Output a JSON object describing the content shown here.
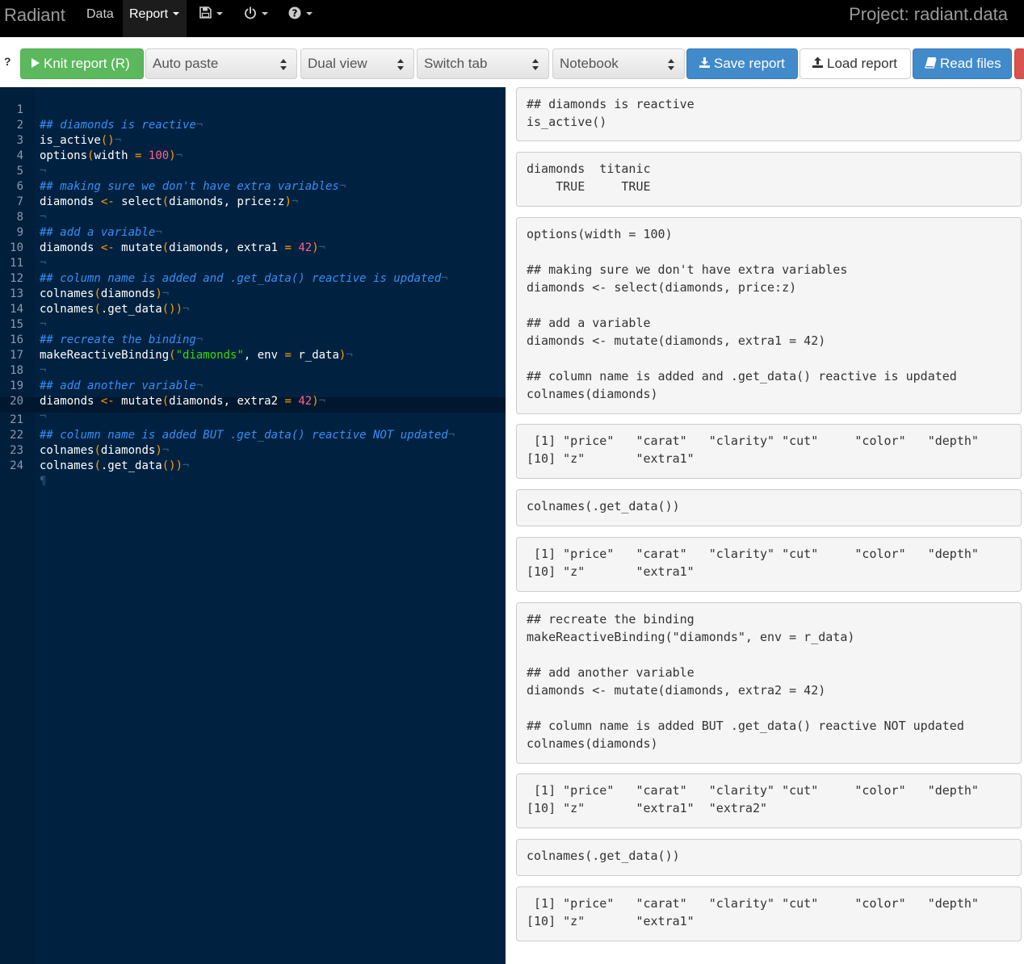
{
  "navbar": {
    "brand": "Radiant",
    "items": [
      {
        "label": "Data"
      },
      {
        "label": "Report"
      }
    ],
    "project": "Project: radiant.data"
  },
  "toolbar": {
    "help": "?",
    "knit_label": "Knit report (R)",
    "auto_paste": "Auto paste",
    "dual_view": "Dual view",
    "switch_tab": "Switch tab",
    "notebook": "Notebook",
    "save_report": "Save report",
    "load_report": "Load report",
    "read_files": "Read files"
  },
  "editor": {
    "lines": [
      "1",
      "2",
      "3",
      "4",
      "5",
      "6",
      "7",
      "8",
      "9",
      "10",
      "11",
      "12",
      "13",
      "14",
      "15",
      "16",
      "17",
      "18",
      "19",
      "20",
      "21",
      "22",
      "23",
      "24"
    ],
    "active_line": 21,
    "code": {
      "l1": "## diamonds is reactive",
      "l2a": "is_active",
      "l2b": "()",
      "l3a": "options",
      "l3b": "(",
      "l3c": "width ",
      "l3d": "=",
      "l3e": " ",
      "l3f": "100",
      "l3g": ")",
      "l5": "## making sure we don't have extra variables",
      "l6a": "diamonds ",
      "l6b": "<-",
      "l6c": " select",
      "l6d": "(",
      "l6e": "diamonds, price:z",
      "l6f": ")",
      "l8": "## add a variable",
      "l9a": "diamonds ",
      "l9b": "<-",
      "l9c": " mutate",
      "l9d": "(",
      "l9e": "diamonds, extra1 ",
      "l9f": "=",
      "l9g": " ",
      "l9h": "42",
      "l9i": ")",
      "l11": "## column name is added and .get_data() reactive is updated",
      "l12a": "colnames",
      "l12b": "(",
      "l12c": "diamonds",
      "l12d": ")",
      "l13a": "colnames",
      "l13b": "(",
      "l13c": ".get_data",
      "l13d": "())",
      "l15": "## recreate the binding",
      "l16a": "makeReactiveBinding",
      "l16b": "(",
      "l16c": "\"diamonds\"",
      "l16d": ", env ",
      "l16e": "=",
      "l16f": " r_data",
      "l16g": ")",
      "l18": "## add another variable",
      "l19a": "diamonds ",
      "l19b": "<-",
      "l19c": " mutate",
      "l19d": "(",
      "l19e": "diamonds, extra2 ",
      "l19f": "=",
      "l19g": " ",
      "l19h": "42",
      "l19i": ")",
      "l21": "## column name is added BUT .get_data() reactive NOT updated",
      "l22a": "colnames",
      "l22b": "(",
      "l22c": "diamonds",
      "l22d": ")",
      "l23a": "colnames",
      "l23b": "(",
      "l23c": ".get_data",
      "l23d": "())",
      "eol": "¬",
      "eof": "¶"
    }
  },
  "output": {
    "blocks": [
      "## diamonds is reactive\nis_active()",
      "diamonds  titanic\n    TRUE     TRUE",
      "options(width = 100)\n\n## making sure we don't have extra variables\ndiamonds <- select(diamonds, price:z)\n\n## add a variable\ndiamonds <- mutate(diamonds, extra1 = 42)\n\n## column name is added and .get_data() reactive is updated\ncolnames(diamonds)",
      " [1] \"price\"   \"carat\"   \"clarity\" \"cut\"     \"color\"   \"depth\"\n[10] \"z\"       \"extra1\"",
      "colnames(.get_data())",
      " [1] \"price\"   \"carat\"   \"clarity\" \"cut\"     \"color\"   \"depth\"\n[10] \"z\"       \"extra1\"",
      "## recreate the binding\nmakeReactiveBinding(\"diamonds\", env = r_data)\n\n## add another variable\ndiamonds <- mutate(diamonds, extra2 = 42)\n\n## column name is added BUT .get_data() reactive NOT updated\ncolnames(diamonds)",
      " [1] \"price\"   \"carat\"   \"clarity\" \"cut\"     \"color\"   \"depth\"\n[10] \"z\"       \"extra1\"  \"extra2\"",
      "colnames(.get_data())",
      " [1] \"price\"   \"carat\"   \"clarity\" \"cut\"     \"color\"   \"depth\"\n[10] \"z\"       \"extra1\""
    ]
  },
  "colors": {
    "navbar_bg": "#000000",
    "editor_bg": "#002240",
    "comment": "#3b8df5",
    "operator": "#ff9d00",
    "number": "#ff628c",
    "string": "#3ad900",
    "knit_green": "#5cb85c",
    "primary_blue": "#428bca"
  },
  "icons": {
    "knit": "play-icon",
    "save_menu": "floppy-disk-icon",
    "power_menu": "power-icon",
    "help_menu": "question-circle-icon",
    "save_report": "download-icon",
    "load_report": "upload-icon",
    "read_files": "book-icon"
  }
}
